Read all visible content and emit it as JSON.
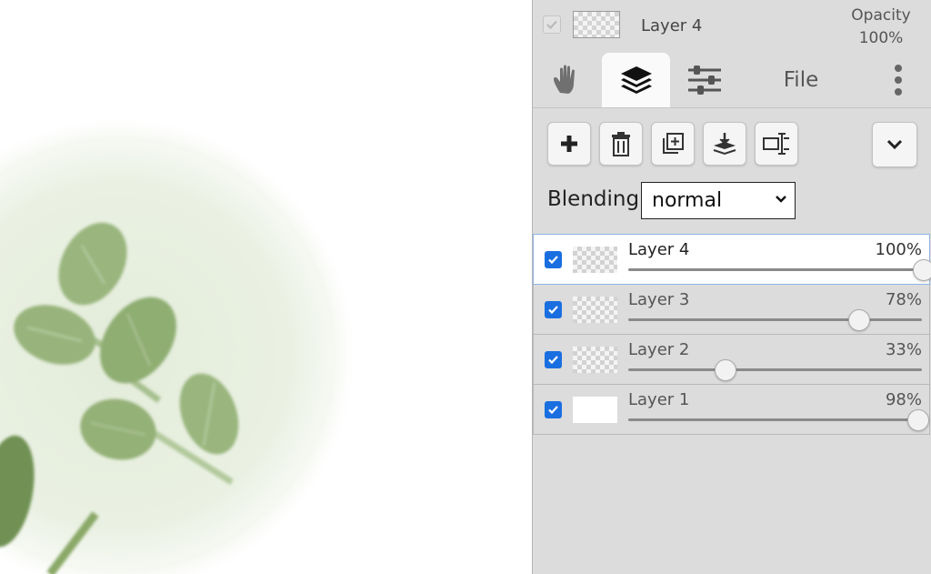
{
  "header": {
    "current_layer_name": "Layer 4",
    "opacity_label": "Opacity",
    "opacity_value": "100%"
  },
  "tabs": [
    {
      "id": "hand",
      "icon": "hand-icon",
      "active": false
    },
    {
      "id": "layers",
      "icon": "layers-icon",
      "active": true
    },
    {
      "id": "adjust",
      "icon": "sliders-icon",
      "active": false
    },
    {
      "id": "file",
      "label": "File",
      "active": false
    },
    {
      "id": "more",
      "icon": "more-vertical-icon",
      "active": false
    }
  ],
  "tabs_file_label": "File",
  "toolbar": {
    "buttons": [
      "add-layer-icon",
      "delete-layer-icon",
      "duplicate-layer-icon",
      "merge-down-icon",
      "rename-layer-icon"
    ],
    "collapse_icon": "chevron-down-icon"
  },
  "blending": {
    "label": "Blending",
    "value": "normal",
    "options": [
      "normal"
    ]
  },
  "layers": [
    {
      "name": "Layer 4",
      "opacity": "100%",
      "opacity_value": 1.0,
      "visible": true,
      "selected": true,
      "thumb": "transparent"
    },
    {
      "name": "Layer 3",
      "opacity": "78%",
      "opacity_value": 0.78,
      "visible": true,
      "selected": false,
      "thumb": "transparent"
    },
    {
      "name": "Layer 2",
      "opacity": "33%",
      "opacity_value": 0.33,
      "visible": true,
      "selected": false,
      "thumb": "transparent"
    },
    {
      "name": "Layer 1",
      "opacity": "98%",
      "opacity_value": 0.98,
      "visible": true,
      "selected": false,
      "thumb": "white"
    }
  ],
  "colors": {
    "panel_bg": "#dcdcdc",
    "checkbox_accent": "#1a6fe0",
    "leaf_green": "#8aa868",
    "canvas_glow": "#e7efdf"
  }
}
